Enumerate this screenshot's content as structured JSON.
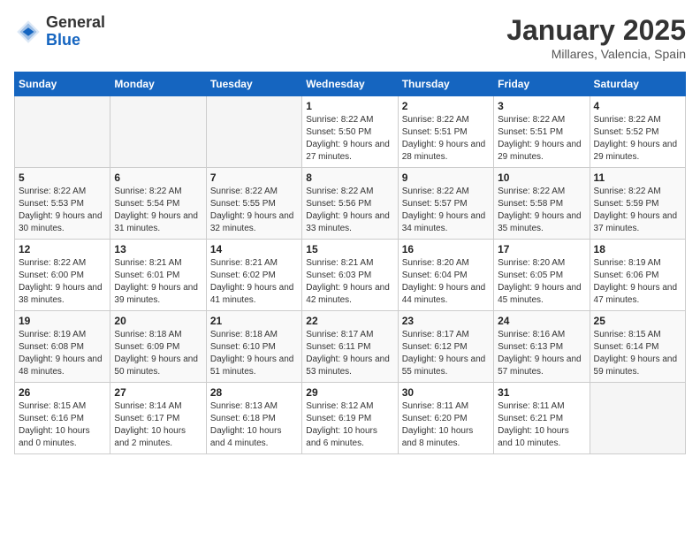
{
  "header": {
    "logo_general": "General",
    "logo_blue": "Blue",
    "month_title": "January 2025",
    "location": "Millares, Valencia, Spain"
  },
  "days_of_week": [
    "Sunday",
    "Monday",
    "Tuesday",
    "Wednesday",
    "Thursday",
    "Friday",
    "Saturday"
  ],
  "weeks": [
    [
      {
        "date": "",
        "sunrise": "",
        "sunset": "",
        "daylight": ""
      },
      {
        "date": "",
        "sunrise": "",
        "sunset": "",
        "daylight": ""
      },
      {
        "date": "",
        "sunrise": "",
        "sunset": "",
        "daylight": ""
      },
      {
        "date": "1",
        "sunrise": "Sunrise: 8:22 AM",
        "sunset": "Sunset: 5:50 PM",
        "daylight": "Daylight: 9 hours and 27 minutes."
      },
      {
        "date": "2",
        "sunrise": "Sunrise: 8:22 AM",
        "sunset": "Sunset: 5:51 PM",
        "daylight": "Daylight: 9 hours and 28 minutes."
      },
      {
        "date": "3",
        "sunrise": "Sunrise: 8:22 AM",
        "sunset": "Sunset: 5:51 PM",
        "daylight": "Daylight: 9 hours and 29 minutes."
      },
      {
        "date": "4",
        "sunrise": "Sunrise: 8:22 AM",
        "sunset": "Sunset: 5:52 PM",
        "daylight": "Daylight: 9 hours and 29 minutes."
      }
    ],
    [
      {
        "date": "5",
        "sunrise": "Sunrise: 8:22 AM",
        "sunset": "Sunset: 5:53 PM",
        "daylight": "Daylight: 9 hours and 30 minutes."
      },
      {
        "date": "6",
        "sunrise": "Sunrise: 8:22 AM",
        "sunset": "Sunset: 5:54 PM",
        "daylight": "Daylight: 9 hours and 31 minutes."
      },
      {
        "date": "7",
        "sunrise": "Sunrise: 8:22 AM",
        "sunset": "Sunset: 5:55 PM",
        "daylight": "Daylight: 9 hours and 32 minutes."
      },
      {
        "date": "8",
        "sunrise": "Sunrise: 8:22 AM",
        "sunset": "Sunset: 5:56 PM",
        "daylight": "Daylight: 9 hours and 33 minutes."
      },
      {
        "date": "9",
        "sunrise": "Sunrise: 8:22 AM",
        "sunset": "Sunset: 5:57 PM",
        "daylight": "Daylight: 9 hours and 34 minutes."
      },
      {
        "date": "10",
        "sunrise": "Sunrise: 8:22 AM",
        "sunset": "Sunset: 5:58 PM",
        "daylight": "Daylight: 9 hours and 35 minutes."
      },
      {
        "date": "11",
        "sunrise": "Sunrise: 8:22 AM",
        "sunset": "Sunset: 5:59 PM",
        "daylight": "Daylight: 9 hours and 37 minutes."
      }
    ],
    [
      {
        "date": "12",
        "sunrise": "Sunrise: 8:22 AM",
        "sunset": "Sunset: 6:00 PM",
        "daylight": "Daylight: 9 hours and 38 minutes."
      },
      {
        "date": "13",
        "sunrise": "Sunrise: 8:21 AM",
        "sunset": "Sunset: 6:01 PM",
        "daylight": "Daylight: 9 hours and 39 minutes."
      },
      {
        "date": "14",
        "sunrise": "Sunrise: 8:21 AM",
        "sunset": "Sunset: 6:02 PM",
        "daylight": "Daylight: 9 hours and 41 minutes."
      },
      {
        "date": "15",
        "sunrise": "Sunrise: 8:21 AM",
        "sunset": "Sunset: 6:03 PM",
        "daylight": "Daylight: 9 hours and 42 minutes."
      },
      {
        "date": "16",
        "sunrise": "Sunrise: 8:20 AM",
        "sunset": "Sunset: 6:04 PM",
        "daylight": "Daylight: 9 hours and 44 minutes."
      },
      {
        "date": "17",
        "sunrise": "Sunrise: 8:20 AM",
        "sunset": "Sunset: 6:05 PM",
        "daylight": "Daylight: 9 hours and 45 minutes."
      },
      {
        "date": "18",
        "sunrise": "Sunrise: 8:19 AM",
        "sunset": "Sunset: 6:06 PM",
        "daylight": "Daylight: 9 hours and 47 minutes."
      }
    ],
    [
      {
        "date": "19",
        "sunrise": "Sunrise: 8:19 AM",
        "sunset": "Sunset: 6:08 PM",
        "daylight": "Daylight: 9 hours and 48 minutes."
      },
      {
        "date": "20",
        "sunrise": "Sunrise: 8:18 AM",
        "sunset": "Sunset: 6:09 PM",
        "daylight": "Daylight: 9 hours and 50 minutes."
      },
      {
        "date": "21",
        "sunrise": "Sunrise: 8:18 AM",
        "sunset": "Sunset: 6:10 PM",
        "daylight": "Daylight: 9 hours and 51 minutes."
      },
      {
        "date": "22",
        "sunrise": "Sunrise: 8:17 AM",
        "sunset": "Sunset: 6:11 PM",
        "daylight": "Daylight: 9 hours and 53 minutes."
      },
      {
        "date": "23",
        "sunrise": "Sunrise: 8:17 AM",
        "sunset": "Sunset: 6:12 PM",
        "daylight": "Daylight: 9 hours and 55 minutes."
      },
      {
        "date": "24",
        "sunrise": "Sunrise: 8:16 AM",
        "sunset": "Sunset: 6:13 PM",
        "daylight": "Daylight: 9 hours and 57 minutes."
      },
      {
        "date": "25",
        "sunrise": "Sunrise: 8:15 AM",
        "sunset": "Sunset: 6:14 PM",
        "daylight": "Daylight: 9 hours and 59 minutes."
      }
    ],
    [
      {
        "date": "26",
        "sunrise": "Sunrise: 8:15 AM",
        "sunset": "Sunset: 6:16 PM",
        "daylight": "Daylight: 10 hours and 0 minutes."
      },
      {
        "date": "27",
        "sunrise": "Sunrise: 8:14 AM",
        "sunset": "Sunset: 6:17 PM",
        "daylight": "Daylight: 10 hours and 2 minutes."
      },
      {
        "date": "28",
        "sunrise": "Sunrise: 8:13 AM",
        "sunset": "Sunset: 6:18 PM",
        "daylight": "Daylight: 10 hours and 4 minutes."
      },
      {
        "date": "29",
        "sunrise": "Sunrise: 8:12 AM",
        "sunset": "Sunset: 6:19 PM",
        "daylight": "Daylight: 10 hours and 6 minutes."
      },
      {
        "date": "30",
        "sunrise": "Sunrise: 8:11 AM",
        "sunset": "Sunset: 6:20 PM",
        "daylight": "Daylight: 10 hours and 8 minutes."
      },
      {
        "date": "31",
        "sunrise": "Sunrise: 8:11 AM",
        "sunset": "Sunset: 6:21 PM",
        "daylight": "Daylight: 10 hours and 10 minutes."
      },
      {
        "date": "",
        "sunrise": "",
        "sunset": "",
        "daylight": ""
      }
    ]
  ]
}
